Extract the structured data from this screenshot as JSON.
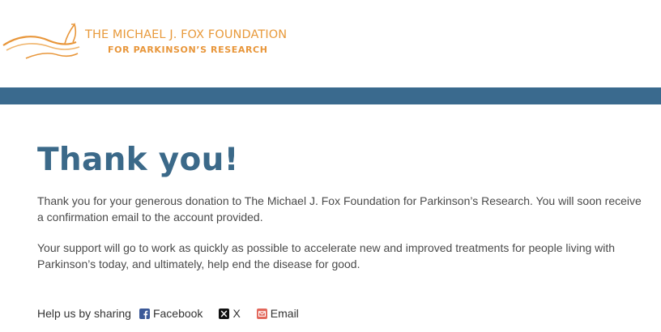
{
  "header": {
    "logo": {
      "line1": "THE MICHAEL J. FOX FOUNDATION",
      "line2": "FOR PARKINSON’S RESEARCH",
      "icon": "fox-swoosh-logo"
    }
  },
  "colors": {
    "brand_orange": "#e89a3c",
    "accent_blue": "#3a6a8e",
    "heading_blue": "#3b6989"
  },
  "main": {
    "title": "Thank you!",
    "paragraph1": "Thank you for your generous donation to The Michael J. Fox Foundation for Parkinson’s Research. You will soon receive a confirmation email to the account provided.",
    "paragraph2": "Your support will go to work as quickly as possible to accelerate new and improved treatments for people living with Parkinson’s today, and ultimately, help end the disease for good."
  },
  "share": {
    "label": "Help us by sharing",
    "links": [
      {
        "label": "Facebook",
        "icon": "facebook-icon"
      },
      {
        "label": "X",
        "icon": "x-icon"
      },
      {
        "label": "Email",
        "icon": "email-icon"
      }
    ]
  }
}
